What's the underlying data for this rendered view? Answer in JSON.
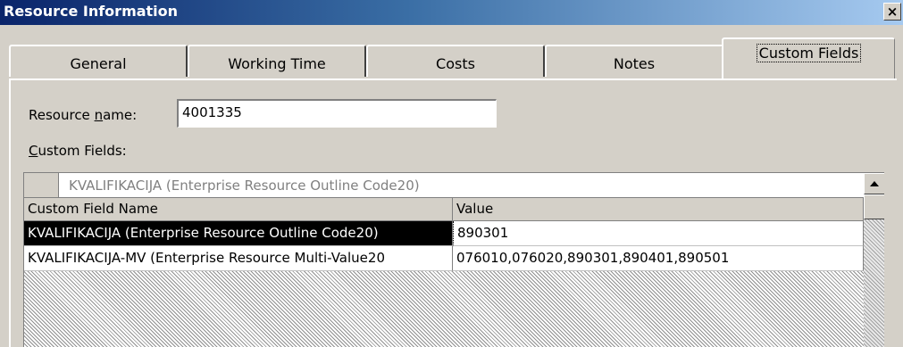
{
  "window": {
    "title": "Resource Information",
    "close_glyph": "×"
  },
  "tabs": [
    {
      "label": "General"
    },
    {
      "label": "Working Time"
    },
    {
      "label": "Costs"
    },
    {
      "label": "Notes"
    },
    {
      "label": "Custom Fields",
      "active": true
    }
  ],
  "resource": {
    "label_pre": "Resource ",
    "label_u": "n",
    "label_post": "ame:",
    "value": "4001335"
  },
  "custom_fields": {
    "label_u": "C",
    "label_post": "ustom Fields:",
    "edit_text": "KVALIFIKACIJA (Enterprise Resource Outline Code20)",
    "columns": {
      "name": "Custom Field Name",
      "value": "Value"
    },
    "rows": [
      {
        "name": "KVALIFIKACIJA (Enterprise Resource Outline Code20)",
        "value": "890301"
      },
      {
        "name": "KVALIFIKACIJA-MV (Enterprise Resource Multi-Value20",
        "value": "076010,076020,890301,890401,890501"
      }
    ]
  },
  "icons": {
    "scroll_up": "up-arrow-icon",
    "close": "close-icon"
  }
}
